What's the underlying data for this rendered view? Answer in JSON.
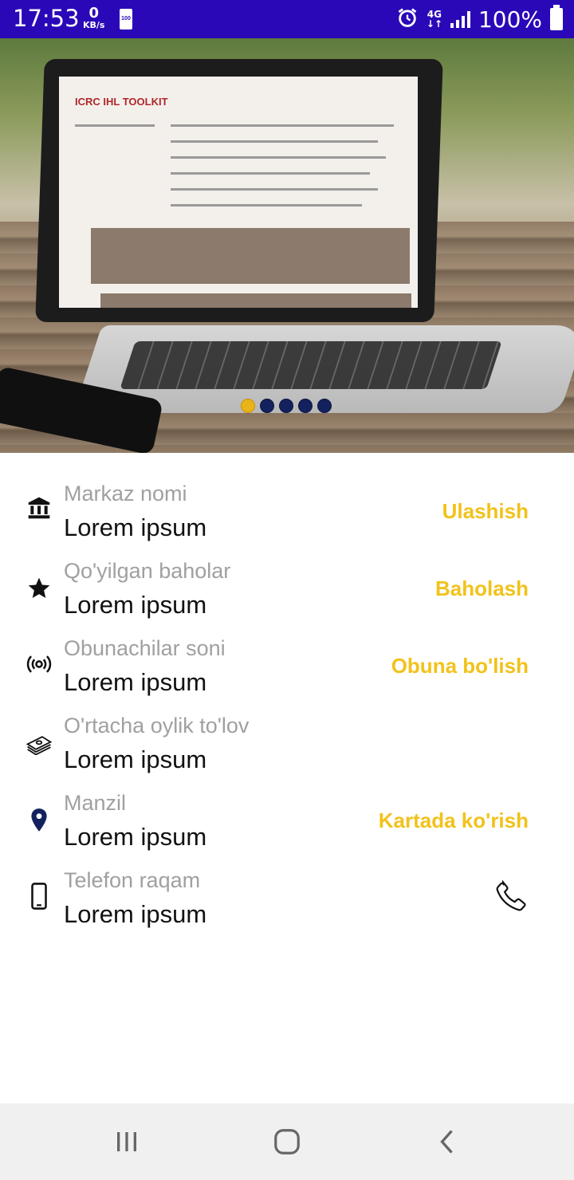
{
  "status_bar": {
    "time": "17:53",
    "net_speed_value": "0",
    "net_speed_unit": "KB/s",
    "small_battery_text": "100",
    "network_type": "4G",
    "battery_percent": "100%"
  },
  "carousel": {
    "slide_count": 5,
    "active_index": 0,
    "image_text": "ICRC IHL TOOLKIT",
    "active_dot_color": "#e8b41a",
    "inactive_dot_color": "#13225e"
  },
  "info_rows": [
    {
      "icon": "bank-icon",
      "label": "Markaz nomi",
      "value": "Lorem ipsum",
      "action": "Ulashish"
    },
    {
      "icon": "star-icon",
      "label": "Qo'yilgan baholar",
      "value": "Lorem ipsum",
      "action": "Baholash"
    },
    {
      "icon": "broadcast-icon",
      "label": "Obunachilar soni",
      "value": "Lorem ipsum",
      "action": "Obuna bo'lish"
    },
    {
      "icon": "money-icon",
      "label": "O'rtacha oylik to'lov",
      "value": "Lorem ipsum",
      "action": ""
    },
    {
      "icon": "location-pin-icon",
      "label": "Manzil",
      "value": "Lorem ipsum",
      "action": "Kartada ko'rish"
    },
    {
      "icon": "mobile-phone-icon",
      "label": "Telefon raqam",
      "value": "Lorem ipsum",
      "action_icon": "phone-call-icon"
    }
  ],
  "colors": {
    "status_bar": "#2a08b8",
    "accent": "#f2c21b",
    "label_gray": "#a0a0a0"
  }
}
